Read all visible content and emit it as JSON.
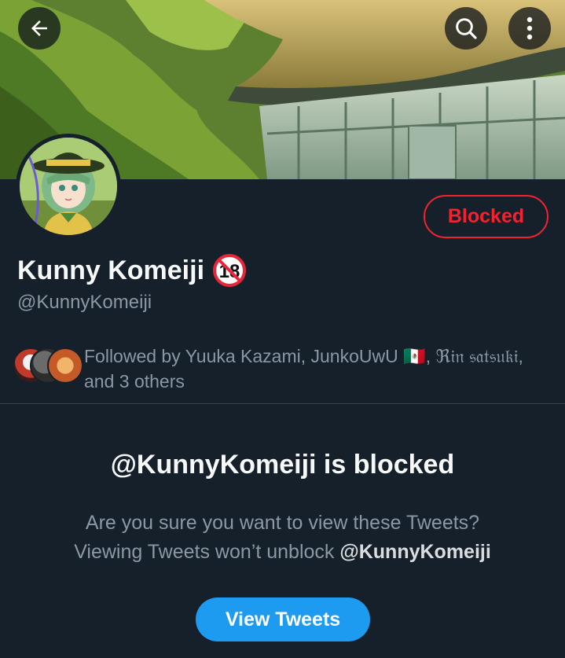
{
  "header": {
    "back_icon": "arrow-left-icon",
    "search_icon": "search-icon",
    "more_icon": "more-vertical-icon"
  },
  "profile": {
    "display_name": "Kunny Komeiji",
    "adult_badge": "18",
    "handle": "@KunnyKomeiji",
    "blocked_button_label": "Blocked"
  },
  "followers": {
    "followed_by_text": "Followed by Yuuka Kazami, JunkoUwU 🇲🇽, ℜ𝔦𝔫 𝔰𝔞𝔱𝔰𝔲𝔨𝔦,",
    "others_text": "and 3 others"
  },
  "blocked_notice": {
    "title": "@KunnyKomeiji is blocked",
    "line1": "Are you sure you want to view these Tweets?",
    "line2_prefix": "Viewing Tweets won’t unblock ",
    "line2_handle": "@KunnyKomeiji",
    "view_button_label": "View Tweets"
  },
  "colors": {
    "background": "#15202b",
    "secondary_text": "#8b98a5",
    "blocked_red": "#f4212e",
    "accent_blue": "#1d9bf0"
  }
}
